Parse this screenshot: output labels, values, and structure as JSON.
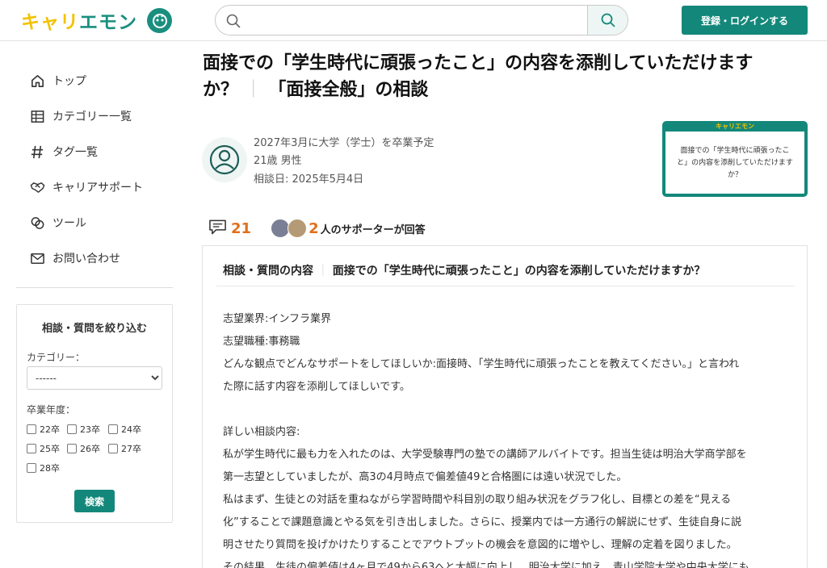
{
  "header": {
    "logo_text": "キャリエモン",
    "search_placeholder": "",
    "login_label": "登録・ログインする"
  },
  "sidebar": {
    "items": [
      {
        "label": "トップ",
        "icon": "home-icon"
      },
      {
        "label": "カテゴリー一覧",
        "icon": "grid-icon"
      },
      {
        "label": "タグ一覧",
        "icon": "hashtag-icon"
      },
      {
        "label": "キャリアサポート",
        "icon": "handshake-icon"
      },
      {
        "label": "ツール",
        "icon": "tools-icon"
      },
      {
        "label": "お問い合わせ",
        "icon": "mail-icon"
      }
    ],
    "filter": {
      "title": "相談・質問を絞り込む",
      "category_label": "カテゴリー：",
      "category_selected": "------",
      "year_label": "卒業年度：",
      "years": [
        "22卒",
        "23卒",
        "24卒",
        "25卒",
        "26卒",
        "27卒",
        "28卒"
      ],
      "submit_label": "検索"
    }
  },
  "main": {
    "title_part1": "面接での「学生時代に頑張ったこと」の内容を添削していただけます",
    "title_part2": "か？",
    "title_sep": "｜",
    "title_part3": "「面接全般」の相談",
    "meta": {
      "graduation": "2027年3月に大学（学士）を卒業予定",
      "profile": "21歳 男性",
      "date": "相談日: 2025年5月4日"
    },
    "card_logo": "キャリエモン",
    "card_text": "面接での「学生時代に頑張ったこと」の内容を添削していただけますか？",
    "stats": {
      "comment_count": "21",
      "supporter_count": "2",
      "supporter_text": "人のサポーターが回答"
    },
    "content": {
      "head_label": "相談・質問の内容",
      "head_sep": "｜",
      "head_title": "面接での「学生時代に頑張ったこと」の内容を添削していただけますか？",
      "lines": [
        "志望業界:インフラ業界",
        "志望職種:事務職",
        "どんな観点でどんなサポートをしてほしいか:面接時、「学生時代に頑張ったことを教えてください。」と言われ",
        "た際に話す内容を添削してほしいです。",
        "詳しい相談内容:",
        "私が学生時代に最も力を入れたのは、大学受験専門の塾での講師アルバイトです。担当生徒は明治大学商学部を",
        "第一志望としていましたが、高3の4月時点で偏差値49と合格圏には遠い状況でした。",
        "私はまず、生徒との対話を重ねながら学習時間や科目別の取り組み状況をグラフ化し、目標との差を“見える",
        "化”することで課題意識とやる気を引き出しました。さらに、授業内では一方通行の解説にせず、生徒自身に説",
        "明させたり質問を投げかけたりすることでアウトプットの機会を意図的に増やし、理解の定着を図りました。",
        "その結果、生徒の偏差値は4ヶ月で49から63へと大幅に向上し、明治大学に加え、青山学院大学や中央大学にも"
      ]
    }
  },
  "colors": {
    "brand": "#13887a",
    "accent": "#e0701c",
    "logo_yellow": "#f2c200"
  }
}
